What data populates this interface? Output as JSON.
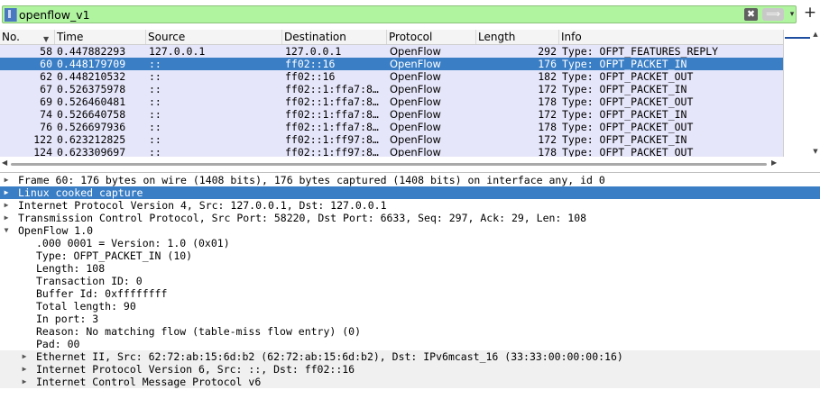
{
  "filter": {
    "value": "openflow_v1",
    "clear_glyph": "✖",
    "apply_glyph": "⟹",
    "dropdown_glyph": "▾",
    "add_glyph": "+"
  },
  "columns": [
    "No.",
    "Time",
    "Source",
    "Destination",
    "Protocol",
    "Length",
    "Info"
  ],
  "packets": [
    {
      "no": "58",
      "time": "0.447882293",
      "src": "127.0.0.1",
      "dst": "127.0.0.1",
      "proto": "OpenFlow",
      "len": "292",
      "info": "Type: OFPT_FEATURES_REPLY"
    },
    {
      "no": "60",
      "time": "0.448179709",
      "src": "::",
      "dst": "ff02::16",
      "proto": "OpenFlow",
      "len": "176",
      "info": "Type: OFPT_PACKET_IN"
    },
    {
      "no": "62",
      "time": "0.448210532",
      "src": "::",
      "dst": "ff02::16",
      "proto": "OpenFlow",
      "len": "182",
      "info": "Type: OFPT_PACKET_OUT"
    },
    {
      "no": "67",
      "time": "0.526375978",
      "src": "::",
      "dst": "ff02::1:ffa7:8…",
      "proto": "OpenFlow",
      "len": "172",
      "info": "Type: OFPT_PACKET_IN"
    },
    {
      "no": "69",
      "time": "0.526460481",
      "src": "::",
      "dst": "ff02::1:ffa7:8…",
      "proto": "OpenFlow",
      "len": "178",
      "info": "Type: OFPT_PACKET_OUT"
    },
    {
      "no": "74",
      "time": "0.526640758",
      "src": "::",
      "dst": "ff02::1:ffa7:8…",
      "proto": "OpenFlow",
      "len": "172",
      "info": "Type: OFPT_PACKET_IN"
    },
    {
      "no": "76",
      "time": "0.526697936",
      "src": "::",
      "dst": "ff02::1:ffa7:8…",
      "proto": "OpenFlow",
      "len": "178",
      "info": "Type: OFPT_PACKET_OUT"
    },
    {
      "no": "122",
      "time": "0.623212825",
      "src": "::",
      "dst": "ff02::1:ff97:8…",
      "proto": "OpenFlow",
      "len": "172",
      "info": "Type: OFPT_PACKET_IN"
    },
    {
      "no": "124",
      "time": "0.623309697",
      "src": "::",
      "dst": "ff02::1:ff97:8…",
      "proto": "OpenFlow",
      "len": "178",
      "info": "Type: OFPT_PACKET_OUT"
    }
  ],
  "selected_packet_no": "60",
  "details": {
    "frame": "Frame 60: 176 bytes on wire (1408 bits), 176 bytes captured (1408 bits) on interface any, id 0",
    "linux_cooked": "Linux cooked capture",
    "ipv4": "Internet Protocol Version 4, Src: 127.0.0.1, Dst: 127.0.0.1",
    "tcp": "Transmission Control Protocol, Src Port: 58220, Dst Port: 6633, Seq: 297, Ack: 29, Len: 108",
    "openflow": "OpenFlow 1.0",
    "of_fields": [
      ".000 0001 = Version: 1.0 (0x01)",
      "Type: OFPT_PACKET_IN (10)",
      "Length: 108",
      "Transaction ID: 0",
      "Buffer Id: 0xffffffff",
      "Total length: 90",
      "In port: 3",
      "Reason: No matching flow (table-miss flow entry) (0)",
      "Pad: 00"
    ],
    "ethernet": "Ethernet II, Src: 62:72:ab:15:6d:b2 (62:72:ab:15:6d:b2), Dst: IPv6mcast_16 (33:33:00:00:00:16)",
    "ipv6": "Internet Protocol Version 6, Src: ::, Dst: ff02::16",
    "icmpv6": "Internet Control Message Protocol v6"
  },
  "colors": {
    "filter_valid_bg": "#b0f4a0",
    "row_bg": "#e6e6fa",
    "selection_bg": "#3a7ec6",
    "selection_fg": "#ffffff"
  }
}
